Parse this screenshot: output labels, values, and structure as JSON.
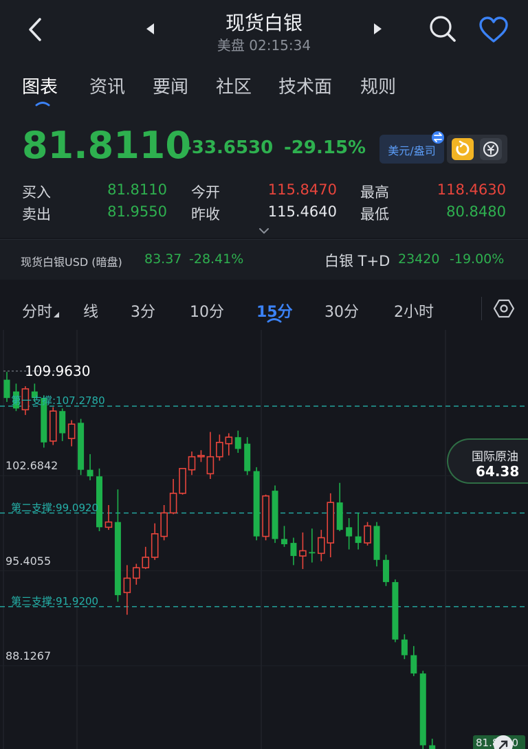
{
  "header": {
    "title": "现货白银",
    "subtitle": "美盘 02:15:34"
  },
  "tabs": [
    {
      "label": "图表",
      "active": true
    },
    {
      "label": "资讯"
    },
    {
      "label": "要闻"
    },
    {
      "label": "社区"
    },
    {
      "label": "技术面"
    },
    {
      "label": "规则"
    }
  ],
  "quote": {
    "price": "81.8110",
    "change": "-33.6530",
    "change_pct": "-29.15%",
    "currency_toggle": "美元/盎司",
    "rows": [
      {
        "label": "买入",
        "value": "81.8110",
        "color": "green"
      },
      {
        "label": "今开",
        "value": "115.8470",
        "color": "red"
      },
      {
        "label": "最高",
        "value": "118.4630",
        "color": "red"
      },
      {
        "label": "卖出",
        "value": "81.9550",
        "color": "green"
      },
      {
        "label": "昨收",
        "value": "115.4640",
        "color": "white"
      },
      {
        "label": "最低",
        "value": "80.8480",
        "color": "green"
      }
    ]
  },
  "related": {
    "left_name": "现货白银USD (暗盘)",
    "left_price": "83.37",
    "left_pct": "-28.41%",
    "right_name": "白银 T+D",
    "right_price": "23420",
    "right_pct": "-19.00%"
  },
  "periods": [
    {
      "label": "分时"
    },
    {
      "label": "线"
    },
    {
      "label": "3分"
    },
    {
      "label": "10分"
    },
    {
      "label": "15分",
      "active": true
    },
    {
      "label": "30分"
    },
    {
      "label": "2小时"
    }
  ],
  "chart_data": {
    "type": "candlestick",
    "high_marker": "109.9630",
    "price_labels": [
      "102.6842",
      "95.4055",
      "88.1267"
    ],
    "price_label_values": [
      102.6842,
      95.4055,
      88.1267
    ],
    "support_lines": [
      {
        "label": "第一支撑:107.2780",
        "value": 107.278
      },
      {
        "label": "第二支撑:99.0920",
        "value": 99.092
      },
      {
        "label": "第三支撑:91.9200",
        "value": 91.92
      }
    ],
    "last_price_tag": "81.8110",
    "floating_tag": {
      "name": "国际原油",
      "value": "64.38"
    },
    "colors": {
      "up": "#e8453c",
      "down": "#1db14b",
      "support": "#25b0a8"
    },
    "candles": [
      [
        109.3,
        109.9,
        107.6,
        107.9
      ],
      [
        108.4,
        109.0,
        106.9,
        107.1
      ],
      [
        107.0,
        108.8,
        106.6,
        108.6
      ],
      [
        108.4,
        109.0,
        107.6,
        107.9
      ],
      [
        107.9,
        108.1,
        104.1,
        104.5
      ],
      [
        104.6,
        107.2,
        104.3,
        106.9
      ],
      [
        106.9,
        107.1,
        104.6,
        105.2
      ],
      [
        104.8,
        106.2,
        104.2,
        105.9
      ],
      [
        106.0,
        106.3,
        102.0,
        102.4
      ],
      [
        102.4,
        103.6,
        101.6,
        101.9
      ],
      [
        101.9,
        102.5,
        97.7,
        98.0
      ],
      [
        98.0,
        99.7,
        97.8,
        98.4
      ],
      [
        98.4,
        100.9,
        92.3,
        92.8
      ],
      [
        93.0,
        95.1,
        91.3,
        94.1
      ],
      [
        94.1,
        95.2,
        93.6,
        94.9
      ],
      [
        94.9,
        96.5,
        94.8,
        95.7
      ],
      [
        95.7,
        98.3,
        95.5,
        97.5
      ],
      [
        97.3,
        99.7,
        97.0,
        99.1
      ],
      [
        99.1,
        101.7,
        99.0,
        100.6
      ],
      [
        100.6,
        102.5,
        100.5,
        102.5
      ],
      [
        102.4,
        103.8,
        102.0,
        103.4
      ],
      [
        103.4,
        103.9,
        103.0,
        103.5
      ],
      [
        102.1,
        105.3,
        101.7,
        103.4
      ],
      [
        103.4,
        105.1,
        103.1,
        104.5
      ],
      [
        104.4,
        105.2,
        103.5,
        104.9
      ],
      [
        104.9,
        105.4,
        103.7,
        104.0
      ],
      [
        104.4,
        104.9,
        102.0,
        102.3
      ],
      [
        102.3,
        102.6,
        97.0,
        97.3
      ],
      [
        97.3,
        100.5,
        97.0,
        100.4
      ],
      [
        100.8,
        101.2,
        96.8,
        97.1
      ],
      [
        97.1,
        98.1,
        96.5,
        96.7
      ],
      [
        96.8,
        97.2,
        95.1,
        95.8
      ],
      [
        95.8,
        97.6,
        94.8,
        96.2
      ],
      [
        96.1,
        97.9,
        95.3,
        96.0
      ],
      [
        96.0,
        97.8,
        95.4,
        97.2
      ],
      [
        96.8,
        100.6,
        95.7,
        99.9
      ],
      [
        99.9,
        101.4,
        97.7,
        97.8
      ],
      [
        98.0,
        98.7,
        96.3,
        97.3
      ],
      [
        97.3,
        99.1,
        96.3,
        96.8
      ],
      [
        96.8,
        98.4,
        96.6,
        98.1
      ],
      [
        98.1,
        98.4,
        95.0,
        95.5
      ],
      [
        95.5,
        95.9,
        93.5,
        93.8
      ],
      [
        93.8,
        94.0,
        89.2,
        89.4
      ],
      [
        89.4,
        89.8,
        87.9,
        88.2
      ],
      [
        88.2,
        88.9,
        86.6,
        86.8
      ],
      [
        86.8,
        87.0,
        80.9,
        81.3
      ],
      [
        81.3,
        81.8,
        80.6,
        80.9
      ]
    ]
  }
}
